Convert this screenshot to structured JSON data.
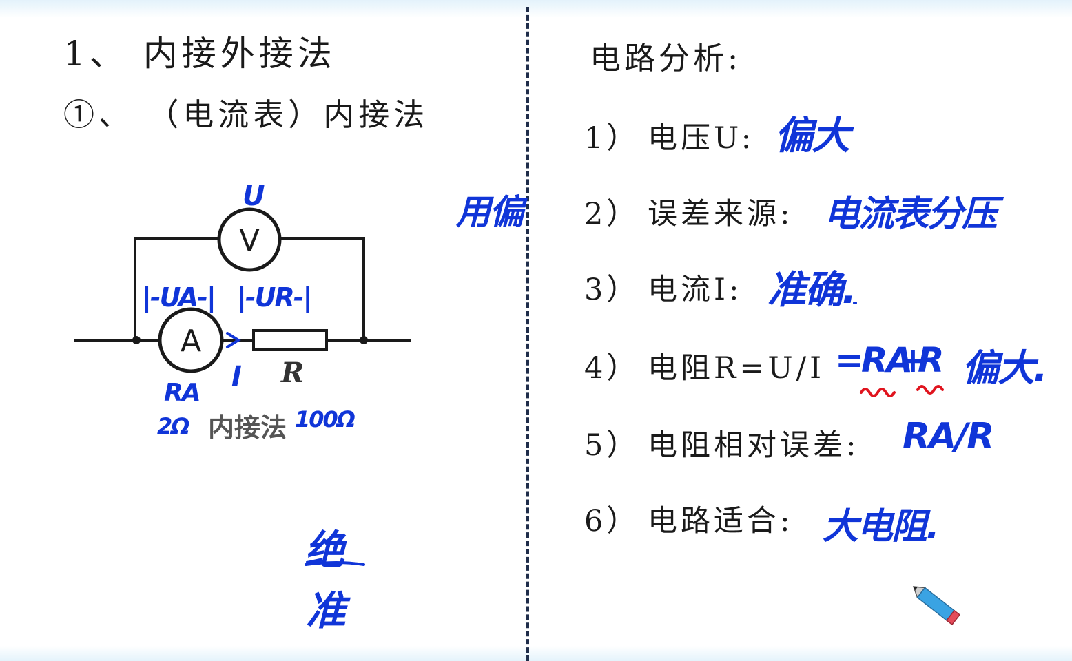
{
  "left": {
    "title": "1、 内接外接法",
    "subtitle": "①、 （电流表）内接法",
    "circuit": {
      "voltmeter": "V",
      "ammeter": "A",
      "resistor": "R",
      "caption": "内接法"
    }
  },
  "right": {
    "title": "电路分析:",
    "items": [
      {
        "num": "1）",
        "label": "电压U:"
      },
      {
        "num": "2）",
        "label": "误差来源:"
      },
      {
        "num": "3）",
        "label": "电流I:"
      },
      {
        "num": "4）",
        "label": "电阻R=U/I"
      },
      {
        "num": "5）",
        "label": "电阻相对误差:"
      },
      {
        "num": "6）",
        "label": "电路适合:"
      }
    ]
  },
  "handwriting": {
    "u_top": "U",
    "ua": "|-UA-|",
    "ur": "|-UR-|",
    "current": "I",
    "ra": "RA",
    "ra_val": "2Ω",
    "r_val": "100Ω",
    "side_note": "用偏",
    "jue": "绝",
    "zhun": "准",
    "a1": "偏大",
    "a2": "电流表分压",
    "a3": "准确.",
    "a4_eq": "=",
    "a4_ra": "RA",
    "a4_plus": "+",
    "a4_r": "R",
    "a4_big": "偏大.",
    "a5": "RA/R",
    "a6": "大电阻."
  },
  "colors": {
    "ink_blue": "#1035d8",
    "ink_red": "#e0141e",
    "divider": "#1f2d4a"
  }
}
